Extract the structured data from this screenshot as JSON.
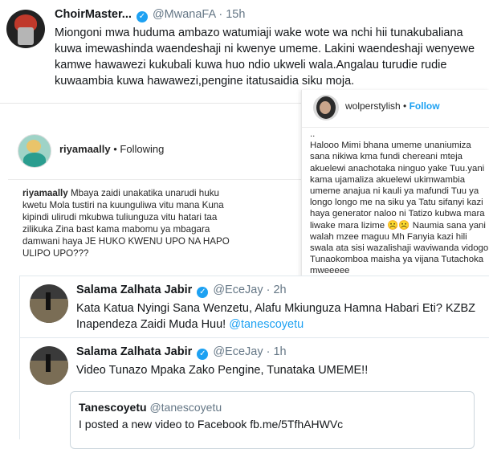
{
  "tweet1": {
    "name": "ChoirMaster...",
    "handle": "@MwanaFA",
    "time": "· 15h",
    "text": "Miongoni mwa huduma ambazo watumiaji wake wote wa nchi hii tunakubaliana kuwa imewashinda waendeshaji ni kwenye umeme. Lakini waendeshaji wenyewe kamwe hawawezi kukubali kuwa huo ndio ukweli wala.Angalau turudie rudie kuwaambia kuwa hawawezi,pengine itatusaidia siku moja."
  },
  "ig_left": {
    "username": "riyamaally",
    "follow_status": "• Following",
    "caption_user": "riyamaally",
    "caption": "Mbaya zaidi unakatika unarudi huku kwetu Mola tustiri na kuunguliwa vitu mana Kuna kipindi ulirudi mkubwa tuliunguza vitu hatari taa zilikuka Zina bast kama mabomu ya mbagara damwani haya JE HUKO KWENU UPO NA HAPO ULIPO UPO???"
  },
  "ig_right": {
    "username": "wolperstylish",
    "follow_label": "Follow",
    "caption": "..\nHalooo Mimi bhana umeme unaniumiza sana nikiwa kma fundi chereani mteja akuelewi anachotaka ninguo yake Tuu.yani kama ujamaliza akuelewi ukimwambia umeme anajua ni kauli ya mafundi Tuu ya longo longo me na siku ya Tatu sifanyi kazi haya generator naloo ni Tatizo kubwa mara liwake mara lizime ☹️☹️ Naumia sana yani walah mzee maguu Mh Fanyia kazi hili swala ata sisi wazalishaji waviwanda vidogo Tunaokomboa maisha ya vijana Tutachoka mweeeee"
  },
  "tweet2": {
    "name": "Salama Zalhata Jabir",
    "handle": "@EceJay",
    "time": "· 2h",
    "text": "Kata Katua Nyingi Sana Wenzetu, Alafu Mkiunguza Hamna Habari Eti? KZBZ Inapendeza Zaidi Muda Huu!",
    "mention": "@tanescoyetu"
  },
  "tweet3": {
    "name": "Salama Zalhata Jabir",
    "handle": "@EceJay",
    "time": "· 1h",
    "text": "Video Tunazo Mpaka Zako Pengine, Tunataka UMEME!!",
    "quote": {
      "name": "Tanescoyetu",
      "handle": "@tanescoyetu",
      "text": "I posted a new video to Facebook fb.me/5TfhAHWVc"
    }
  },
  "colors": {
    "twitter_blue": "#1da1f2",
    "text": "#14171a",
    "muted": "#657786",
    "border": "#e1e8ed"
  },
  "icons": [
    "verified-badge-icon"
  ]
}
